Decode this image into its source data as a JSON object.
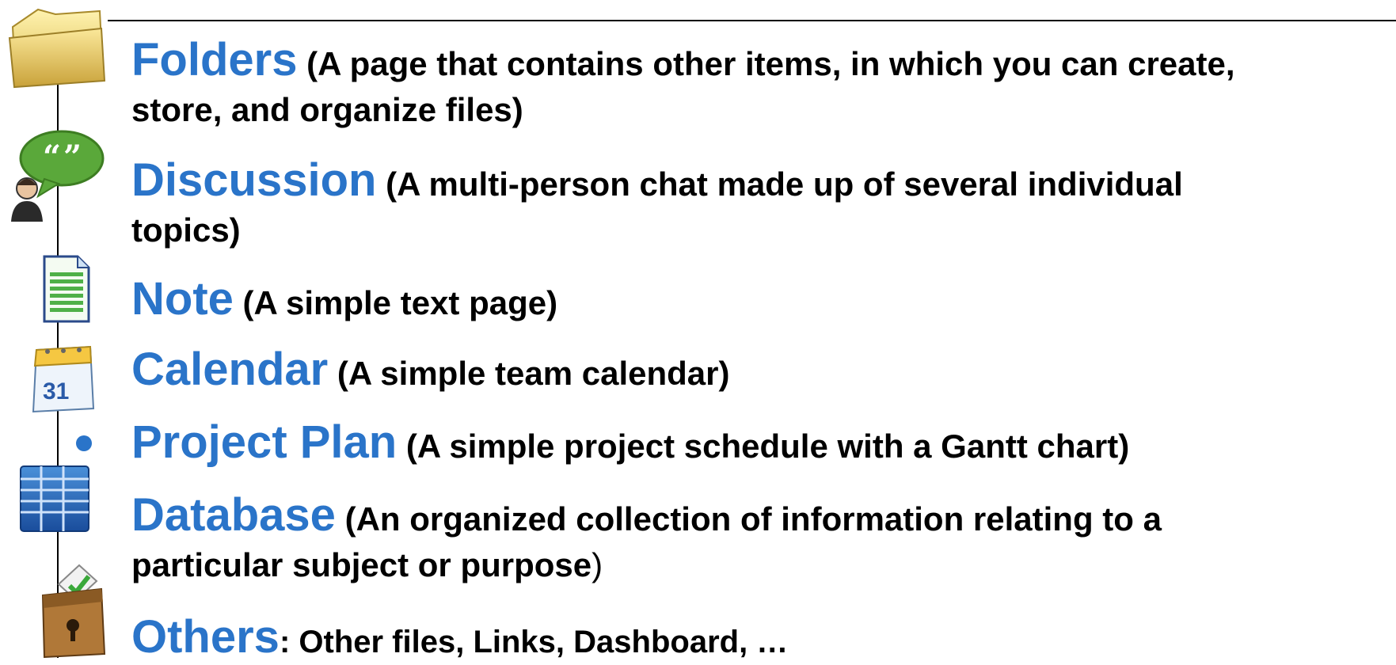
{
  "items": [
    {
      "title": "Folders",
      "desc_line1": " (A page that contains other items, in which you can create,",
      "desc_line2": "store, and organize files)",
      "icon": "folder-icon"
    },
    {
      "title": "Discussion",
      "desc_line1": " (A multi-person chat made up of several individual",
      "desc_line2": "topics)",
      "icon": "discussion-icon"
    },
    {
      "title": "Note",
      "desc_line1": " (A simple text page)",
      "icon": "note-icon"
    },
    {
      "title": "Calendar",
      "desc_line1": " (A simple team calendar)",
      "icon": "calendar-icon",
      "calendar_day": "31"
    },
    {
      "title": "Project Plan",
      "desc_line1": " (A simple project schedule with a Gantt chart)",
      "bullet": "•"
    },
    {
      "title": "Database",
      "desc_line1": " (An organized collection of information relating to a",
      "desc_line2": "particular subject or purpose",
      "desc_line2_end": ")",
      "icon": "database-icon"
    },
    {
      "title": "Others",
      "desc_line1": ": Other files, Links, Dashboard, …",
      "icon": "lockbox-icon"
    }
  ],
  "colors": {
    "title": "#2a74c9",
    "text": "#000000",
    "rule": "#000000"
  }
}
